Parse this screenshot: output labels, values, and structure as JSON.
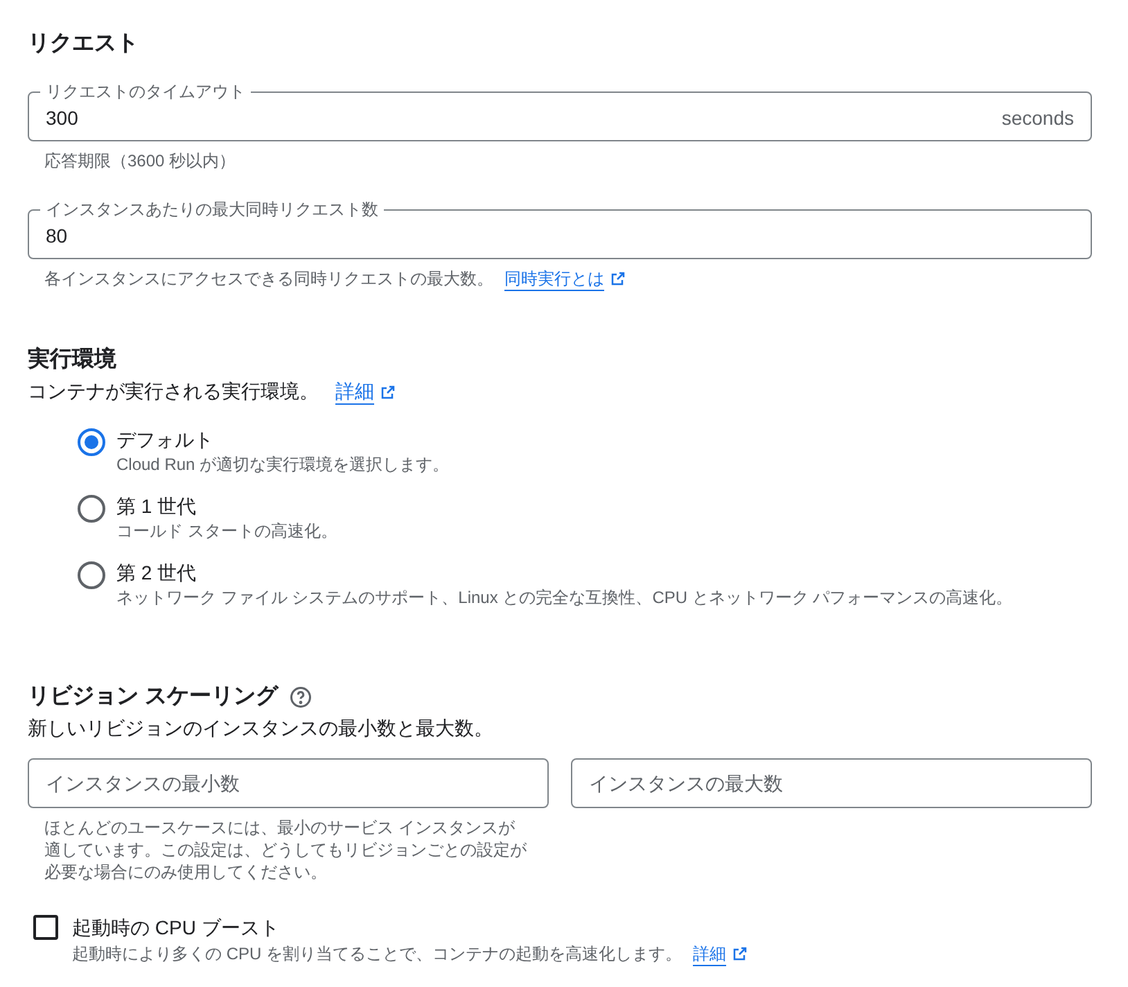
{
  "request": {
    "title": "リクエスト",
    "fields": [
      {
        "label": "リクエストのタイムアウト",
        "value": "300",
        "suffix": "seconds",
        "hint": "応答期限（3600 秒以内）"
      },
      {
        "label": "インスタンスあたりの最大同時リクエスト数",
        "value": "80",
        "hint": "各インスタンスにアクセスできる同時リクエストの最大数。",
        "link": "同時実行とは"
      }
    ]
  },
  "execution_environment": {
    "title": "実行環境",
    "description": "コンテナが実行される実行環境。",
    "link": "詳細",
    "options": [
      {
        "label": "デフォルト",
        "description": "Cloud Run が適切な実行環境を選択します。",
        "selected": true
      },
      {
        "label": "第 1 世代",
        "description": "コールド スタートの高速化。",
        "selected": false
      },
      {
        "label": "第 2 世代",
        "description": "ネットワーク ファイル システムのサポート、Linux との完全な互換性、CPU とネットワーク パフォーマンスの高速化。",
        "selected": false
      }
    ]
  },
  "revision_scaling": {
    "title": "リビジョン スケーリング",
    "description": "新しいリビジョンのインスタンスの最小数と最大数。",
    "min_field": {
      "placeholder": "インスタンスの最小数",
      "hint": "ほとんどのユースケースには、最小のサービス インスタンスが適しています。この設定は、どうしてもリビジョンごとの設定が必要な場合にのみ使用してください。"
    },
    "max_field": {
      "placeholder": "インスタンスの最大数"
    }
  },
  "cpu_boost": {
    "label": "起動時の CPU ブースト",
    "checked": false,
    "description": "起動時により多くの CPU を割り当てることで、コンテナの起動を高速化します。",
    "link": "詳細"
  }
}
